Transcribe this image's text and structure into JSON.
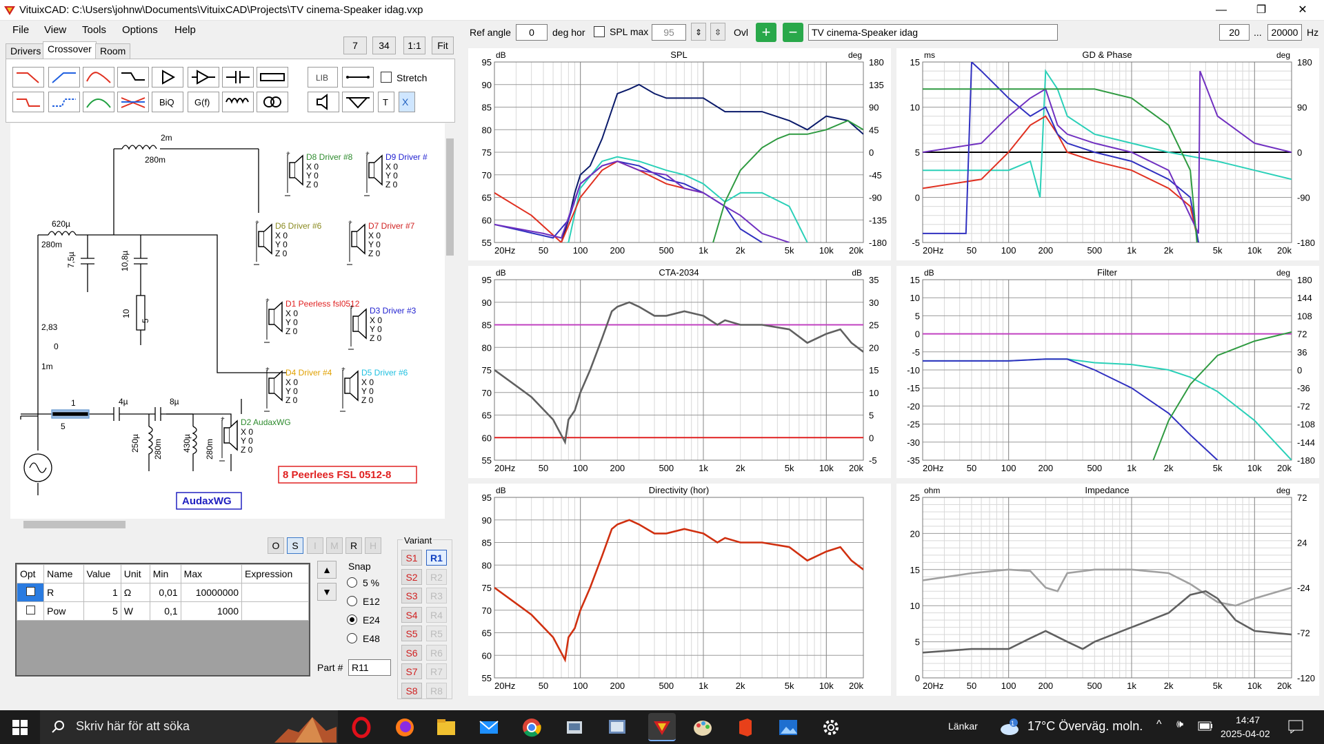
{
  "window": {
    "title": "VituixCAD: C:\\Users\\johnw\\Documents\\VituixCAD\\Projects\\TV cinema-Speaker idag.vxp",
    "min": "—",
    "max": "❐",
    "close": "✕"
  },
  "menu": [
    "File",
    "View",
    "Tools",
    "Options",
    "Help"
  ],
  "left_toolbar": {
    "zoom_a": "7",
    "zoom_b": "34",
    "one_to_one": "1:1",
    "fit": "Fit"
  },
  "tabs": [
    "Drivers",
    "Crossover",
    "Room"
  ],
  "tools_row1": [
    "lowpass-1",
    "highpass-1",
    "bandpass",
    "shelf",
    "buffer",
    "opamp",
    "capacitor",
    "resistor",
    "LIB",
    "wire"
  ],
  "tools_row2": [
    "lowpass-2",
    "highpass-2",
    "peak",
    "notch",
    "BiQ",
    "G(f)",
    "inductor",
    "transformer",
    "speaker",
    "ground",
    "T",
    "X"
  ],
  "stretch_label": "Stretch",
  "schematic": {
    "labels": {
      "l_2m": "2m",
      "l_280m_a": "280m",
      "l_620u": "620µ",
      "l_280m_b": "280m",
      "c_7u5": "7,5µ",
      "c_10u8": "10,8µ",
      "r_10": "10",
      "r_5": "5",
      "src_v": "2,83",
      "src_0": "0",
      "src_1m": "1m",
      "r_1": "1",
      "r_5b": "5",
      "c_4u": "4µ",
      "c_8u": "8µ",
      "l_250u": "250µ",
      "l_280m_c": "280m",
      "l_430u": "430µ",
      "l_280m_d": "280m"
    },
    "drivers": [
      {
        "name": "D8 Driver #8",
        "color": "#2e8b2e"
      },
      {
        "name": "D9 Driver #",
        "color": "#2020d0"
      },
      {
        "name": "D6 Driver #6",
        "color": "#8a8a20"
      },
      {
        "name": "D7 Driver #7",
        "color": "#d02020"
      },
      {
        "name": "D1 Peerless fsl0512",
        "color": "#e02020"
      },
      {
        "name": "D3 Driver #3",
        "color": "#2020d0"
      },
      {
        "name": "D4 Driver #4",
        "color": "#e0a000"
      },
      {
        "name": "D5 Driver #6",
        "color": "#20c0e0"
      },
      {
        "name": "D2 AudaxWG",
        "color": "#2e8b2e"
      }
    ],
    "xyz": [
      "X 0",
      "Y 0",
      "Z 0"
    ],
    "box_red": "8 Peerlees FSL 0512-8",
    "box_blue": "AudaxWG"
  },
  "mode_buttons": [
    "O",
    "S",
    "I",
    "M",
    "R",
    "H"
  ],
  "param_table": {
    "headers": [
      "Opt",
      "Name",
      "Value",
      "Unit",
      "Min",
      "Max",
      "Expression"
    ],
    "rows": [
      {
        "name": "R",
        "value": "1",
        "unit": "Ω",
        "min": "0,01",
        "max": "10000000",
        "expr": ""
      },
      {
        "name": "Pow",
        "value": "5",
        "unit": "W",
        "min": "0,1",
        "max": "1000",
        "expr": ""
      }
    ]
  },
  "snap": {
    "label": "Snap",
    "options": [
      "5 %",
      "E12",
      "E24",
      "E48"
    ],
    "selected": "E24"
  },
  "part": {
    "label": "Part #",
    "value": "R11"
  },
  "variant": {
    "label": "Variant",
    "s": [
      "S1",
      "S2",
      "S3",
      "S4",
      "S5",
      "S6",
      "S7",
      "S8"
    ],
    "r": [
      "R1",
      "R2",
      "R3",
      "R4",
      "R5",
      "R6",
      "R7",
      "R8"
    ]
  },
  "top_controls": {
    "ref_angle_label": "Ref angle",
    "ref_angle": "0",
    "deg_hor": "deg hor",
    "splmax_label": "SPL max",
    "splmax": "95",
    "ovl": "Ovl",
    "project": "TV cinema-Speaker idag",
    "f_min": "20",
    "dots": "...",
    "f_max": "20000",
    "hz": "Hz"
  },
  "xticks": [
    "20Hz",
    "50",
    "100",
    "200",
    "500",
    "1k",
    "2k",
    "5k",
    "10k",
    "20k"
  ],
  "chart_data": [
    {
      "type": "line",
      "title": "SPL",
      "ylabel_left": "dB",
      "ylabel_right": "deg",
      "yticks_left": [
        "95",
        "90",
        "85",
        "80",
        "75",
        "70",
        "65",
        "60",
        "55"
      ],
      "yticks_right": [
        "180",
        "135",
        "90",
        "45",
        "0",
        "-45",
        "-90",
        "-135",
        "-180"
      ],
      "ylim": [
        55,
        95
      ],
      "xlim": [
        20,
        20000
      ],
      "series": [
        {
          "color": "#0a1a6a",
          "x": [
            20,
            60,
            70,
            80,
            90,
            100,
            120,
            150,
            200,
            250,
            300,
            400,
            500,
            700,
            1000,
            1500,
            2000,
            3000,
            5000,
            7000,
            10000,
            15000,
            20000
          ],
          "y": [
            49,
            52,
            55,
            60,
            66,
            70,
            72,
            78,
            88,
            89,
            90,
            88,
            87,
            87,
            87,
            84,
            84,
            84,
            82,
            80,
            83,
            82,
            79
          ]
        },
        {
          "color": "#2ad0b8",
          "x": [
            20,
            80,
            100,
            150,
            200,
            300,
            500,
            700,
            1000,
            1500,
            2000,
            3000,
            5000,
            7000
          ],
          "y": [
            52,
            55,
            67,
            73,
            74,
            73,
            71,
            70,
            68,
            64,
            66,
            66,
            63,
            55
          ]
        },
        {
          "color": "#3030c0",
          "x": [
            20,
            60,
            80,
            100,
            150,
            200,
            300,
            500,
            700,
            1000,
            1500,
            2000,
            3000
          ],
          "y": [
            59,
            56,
            60,
            68,
            72,
            73,
            72,
            69,
            68,
            66,
            63,
            58,
            55
          ]
        },
        {
          "color": "#e03020",
          "x": [
            20,
            40,
            70,
            100,
            150,
            200,
            300,
            500,
            700,
            1000
          ],
          "y": [
            66,
            61,
            55,
            65,
            71,
            73,
            71,
            68,
            67,
            66
          ]
        },
        {
          "color": "#7030c0",
          "x": [
            20,
            50,
            70,
            100,
            150,
            200,
            300,
            500,
            700,
            1000,
            1500,
            2000,
            3000,
            5000
          ],
          "y": [
            59,
            57,
            56,
            68,
            72,
            73,
            71,
            70,
            67,
            66,
            63,
            61,
            57,
            55
          ]
        },
        {
          "color": "#2e9a40",
          "x": [
            1200,
            1500,
            2000,
            3000,
            4000,
            5000,
            7000,
            10000,
            15000,
            20000
          ],
          "y": [
            55,
            64,
            71,
            76,
            78,
            79,
            79,
            80,
            82,
            80
          ]
        }
      ]
    },
    {
      "type": "line",
      "title": "GD & Phase",
      "ylabel_left": "ms",
      "ylabel_right": "deg",
      "yticks_left": [
        "15",
        "10",
        "5",
        "0",
        "-5"
      ],
      "yticks_right": [
        "180",
        "90",
        "0",
        "-90",
        "-180"
      ],
      "ylim": [
        -5,
        15
      ],
      "xlim": [
        20,
        20000
      ],
      "series": [
        {
          "color": "#000000",
          "x": [
            20,
            20000
          ],
          "y": [
            5,
            5
          ]
        },
        {
          "color": "#2ad0b8",
          "x": [
            20,
            100,
            150,
            180,
            200,
            250,
            300,
            500,
            1000,
            2000,
            5000,
            10000,
            20000
          ],
          "y": [
            3,
            3,
            4,
            0,
            14,
            12,
            9,
            7,
            6,
            5,
            4,
            3,
            2
          ]
        },
        {
          "color": "#e03020",
          "x": [
            20,
            60,
            100,
            150,
            200,
            250,
            300,
            500,
            1000,
            2000,
            3000,
            3500
          ],
          "y": [
            1,
            2,
            5,
            8,
            9,
            7,
            5,
            4,
            3,
            1,
            -1,
            -5
          ]
        },
        {
          "color": "#3030c0",
          "x": [
            20,
            45,
            50,
            60,
            100,
            150,
            200,
            250,
            300,
            500,
            1000,
            2000,
            3000,
            3500
          ],
          "y": [
            -4,
            -4,
            15,
            14,
            11,
            9,
            10,
            7,
            6,
            5,
            4,
            2,
            0,
            -5
          ]
        },
        {
          "color": "#7030c0",
          "x": [
            20,
            60,
            100,
            150,
            200,
            250,
            300,
            500,
            1000,
            2000,
            3500,
            3600,
            5000,
            10000,
            20000
          ],
          "y": [
            5,
            6,
            9,
            11,
            12,
            8,
            7,
            6,
            5,
            3,
            -4,
            14,
            9,
            6,
            5
          ]
        },
        {
          "color": "#2e9a40",
          "x": [
            20,
            500,
            1000,
            2000,
            3000,
            3400
          ],
          "y": [
            12,
            12,
            11,
            8,
            3,
            -5
          ]
        }
      ]
    },
    {
      "type": "line",
      "title": "CTA-2034",
      "ylabel_left": "dB",
      "ylabel_right": "dB",
      "yticks_left": [
        "95",
        "90",
        "85",
        "80",
        "75",
        "70",
        "65",
        "60",
        "55"
      ],
      "yticks_right": [
        "35",
        "30",
        "25",
        "20",
        "15",
        "10",
        "5",
        "0",
        "-5"
      ],
      "ylim": [
        55,
        95
      ],
      "xlim": [
        20,
        20000
      ],
      "series": [
        {
          "color": "#c040c0",
          "x": [
            20,
            20000
          ],
          "y": [
            85,
            85
          ]
        },
        {
          "color": "#e02020",
          "x": [
            20,
            20000
          ],
          "y": [
            60,
            60
          ]
        },
        {
          "color": "#606060",
          "x": [
            20,
            40,
            60,
            75,
            80,
            90,
            100,
            120,
            150,
            180,
            200,
            250,
            300,
            400,
            500,
            700,
            1000,
            1300,
            1500,
            2000,
            3000,
            5000,
            7000,
            10000,
            13000,
            16000,
            20000
          ],
          "y": [
            75,
            69,
            64,
            59,
            64,
            66,
            70,
            75,
            82,
            88,
            89,
            90,
            89,
            87,
            87,
            88,
            87,
            85,
            86,
            85,
            85,
            84,
            81,
            83,
            84,
            81,
            79
          ]
        }
      ]
    },
    {
      "type": "line",
      "title": "Filter",
      "ylabel_left": "dB",
      "ylabel_right": "deg",
      "yticks_left": [
        "15",
        "10",
        "5",
        "0",
        "-5",
        "-10",
        "-15",
        "-20",
        "-25",
        "-30",
        "-35"
      ],
      "yticks_right": [
        "180",
        "144",
        "108",
        "72",
        "36",
        "0",
        "-36",
        "-72",
        "-108",
        "-144",
        "-180"
      ],
      "ylim": [
        -35,
        15
      ],
      "xlim": [
        20,
        20000
      ],
      "series": [
        {
          "color": "#c040c0",
          "x": [
            20,
            20000
          ],
          "y": [
            0,
            0
          ]
        },
        {
          "color": "#2ad0b8",
          "x": [
            20,
            100,
            200,
            300,
            500,
            1000,
            2000,
            3000,
            5000,
            10000,
            20000
          ],
          "y": [
            -7.5,
            -7.5,
            -7,
            -7,
            -8,
            -8.5,
            -10,
            -12,
            -16,
            -24,
            -35
          ]
        },
        {
          "color": "#3030c0",
          "x": [
            20,
            100,
            200,
            300,
            500,
            1000,
            2000,
            3000,
            5000
          ],
          "y": [
            -7.5,
            -7.5,
            -7,
            -7,
            -10,
            -15,
            -22,
            -28,
            -35
          ]
        },
        {
          "color": "#2e9a40",
          "x": [
            1500,
            2000,
            3000,
            5000,
            10000,
            20000
          ],
          "y": [
            -35,
            -24,
            -14,
            -6,
            -2,
            0.5
          ]
        }
      ]
    },
    {
      "type": "line",
      "title": "Directivity (hor)",
      "ylabel_left": "dB",
      "yticks_left": [
        "95",
        "90",
        "85",
        "80",
        "75",
        "70",
        "65",
        "60",
        "55"
      ],
      "ylim": [
        55,
        95
      ],
      "xlim": [
        20,
        20000
      ],
      "series": [
        {
          "color": "#d03010",
          "x": [
            20,
            40,
            60,
            75,
            80,
            90,
            100,
            120,
            150,
            180,
            200,
            250,
            300,
            400,
            500,
            700,
            1000,
            1300,
            1500,
            2000,
            3000,
            5000,
            7000,
            10000,
            13000,
            16000,
            20000
          ],
          "y": [
            75,
            69,
            64,
            59,
            64,
            66,
            70,
            75,
            82,
            88,
            89,
            90,
            89,
            87,
            87,
            88,
            87,
            85,
            86,
            85,
            85,
            84,
            81,
            83,
            84,
            81,
            79
          ]
        }
      ]
    },
    {
      "type": "line",
      "title": "Impedance",
      "ylabel_left": "ohm",
      "ylabel_right": "deg",
      "yticks_left": [
        "25",
        "20",
        "15",
        "10",
        "5",
        "0"
      ],
      "yticks_right": [
        "72",
        "24",
        "-24",
        "-72",
        "-120"
      ],
      "ylim": [
        0,
        25
      ],
      "xlim": [
        20,
        20000
      ],
      "series": [
        {
          "color": "#a0a0a0",
          "x": [
            20,
            50,
            100,
            150,
            200,
            250,
            300,
            500,
            1000,
            2000,
            3000,
            5000,
            7000,
            10000,
            20000
          ],
          "y": [
            13.5,
            14.5,
            15,
            14.8,
            12.5,
            12,
            14.5,
            15,
            15,
            14.5,
            13,
            10.5,
            10,
            11,
            12.5
          ]
        },
        {
          "color": "#606060",
          "x": [
            20,
            50,
            100,
            150,
            200,
            300,
            400,
            500,
            1000,
            2000,
            3000,
            4000,
            5000,
            7000,
            10000,
            20000
          ],
          "y": [
            3.5,
            4,
            4,
            5.5,
            6.5,
            5,
            4,
            5,
            7,
            9,
            11.5,
            12,
            11,
            8,
            6.5,
            6
          ]
        }
      ]
    }
  ],
  "taskbar": {
    "search": "Skriv här för att söka",
    "links": "Länkar",
    "weather": "17°C  Överväg. moln.",
    "time": "14:47",
    "date": "2025-04-02"
  }
}
